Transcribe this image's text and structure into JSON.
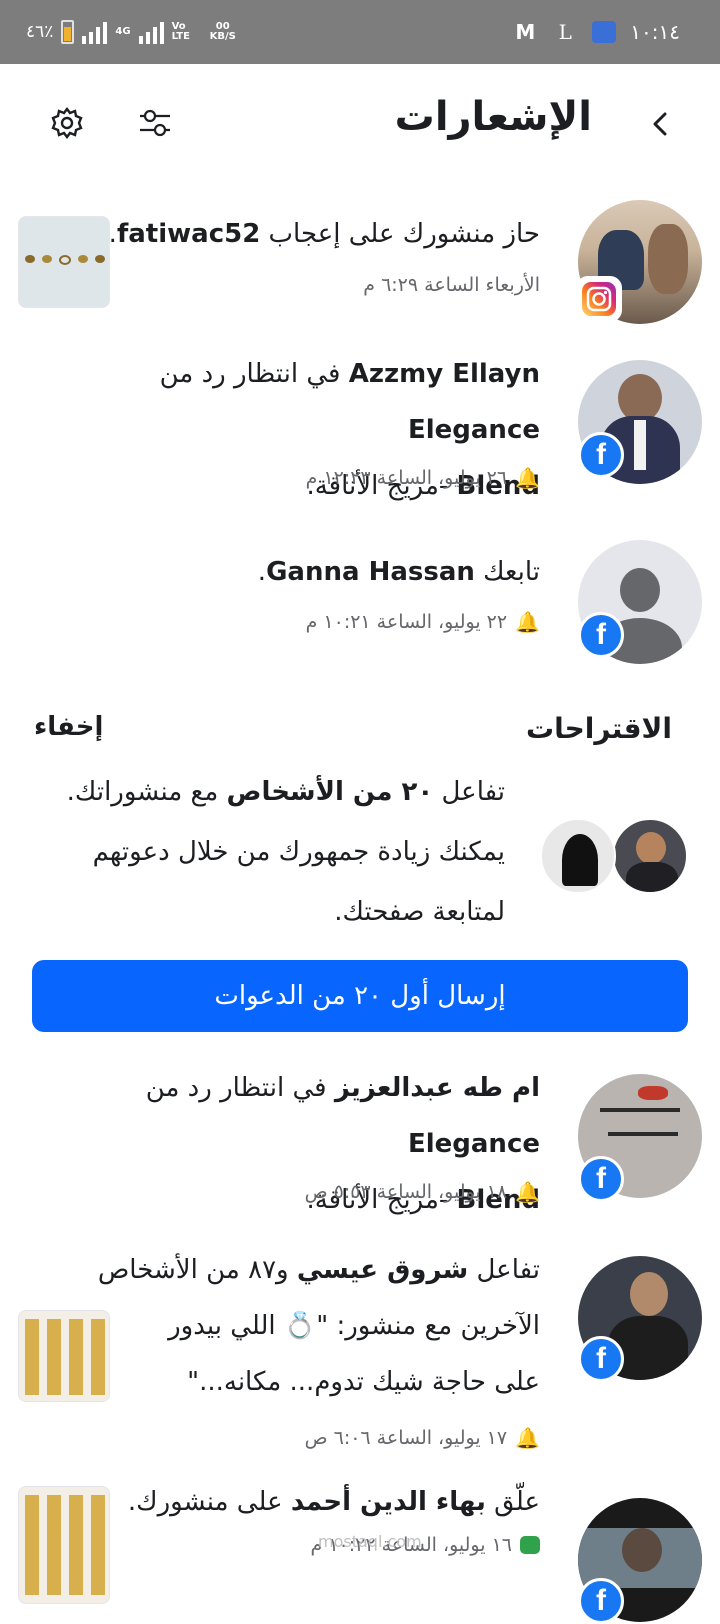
{
  "status_bar": {
    "time": "١٠:١٤",
    "battery": "٤٦٪",
    "network": "4G",
    "volte": "Vo LTE",
    "speed_top": "00",
    "speed_unit": "KB/S",
    "app_m": "M",
    "app_l": "L"
  },
  "header": {
    "title": "الإشعارات",
    "back_icon": "chevron-right-icon",
    "filter_icon": "sliders-icon",
    "settings_icon": "gear-icon"
  },
  "notifications_top": [
    {
      "text_pre": "حاز منشورك على إعجاب ",
      "bold": "fatiwac52",
      "text_post": ".",
      "time": "الأربعاء الساعة ٦:٢٩ م",
      "badge": "instagram-icon",
      "has_thumb": true
    },
    {
      "bold": "Azzmy Ellayn",
      "text_mid": " في انتظار رد من ",
      "bold2": "Elegance",
      "line2_bold": "Blend",
      "line2": " -مزيج الأناقة.",
      "time": "٢٦ يوليو، الساعة ١٢:٢٣ م",
      "badge": "facebook-icon"
    },
    {
      "text_pre": "تابعك ",
      "bold": "Ganna Hassan",
      "text_post": ".",
      "time": "٢٢ يوليو، الساعة ١٠:٢١ م",
      "badge": "facebook-icon"
    }
  ],
  "suggestions": {
    "title": "الاقتراحات",
    "hide": "إخفاء",
    "line1_pre": "تفاعل ",
    "line1_bold": "٢٠ من الأشخاص",
    "line1_post": " مع منشوراتك.",
    "line2": "يمكنك زيادة جمهورك من خلال دعوتهم",
    "line3": "لمتابعة صفحتك.",
    "button": "إرسال أول ٢٠ من الدعوات"
  },
  "notifications_bottom": [
    {
      "bold": "ام طه عبدالعزيز",
      "text_mid": " في انتظار رد من ",
      "bold2": "Elegance",
      "line2_bold": "Blend",
      "line2": " -مزيج الأناقة.",
      "time": "١٨ يوليو، الساعة ٥:٥٣ ص",
      "badge": "facebook-icon"
    },
    {
      "text_pre": "تفاعل ",
      "bold": "شروق عيسي",
      "text_post": " و٨٧ من الأشخاص",
      "line2": "الآخرين مع منشور: \"💍 اللي بيدور",
      "line3": "على حاجة شيك تدوم... مكانه...\"",
      "time": "١٧ يوليو، الساعة ٦:٠٦ ص",
      "badge": "facebook-icon",
      "has_thumb": true
    },
    {
      "text_pre": "علّق ",
      "bold": "بهاء الدين أحمد",
      "text_post": " على منشورك.",
      "time": "١٦ يوليو، الساعة ١٠:٢٢ م",
      "badge": "facebook-icon",
      "has_thumb": true
    }
  ],
  "watermark": "mostaql.com",
  "colors": {
    "facebook_blue": "#1877f2",
    "button_blue": "#0866ff",
    "status_bar": "#7d7d7d",
    "secondary_text": "#65676b"
  }
}
